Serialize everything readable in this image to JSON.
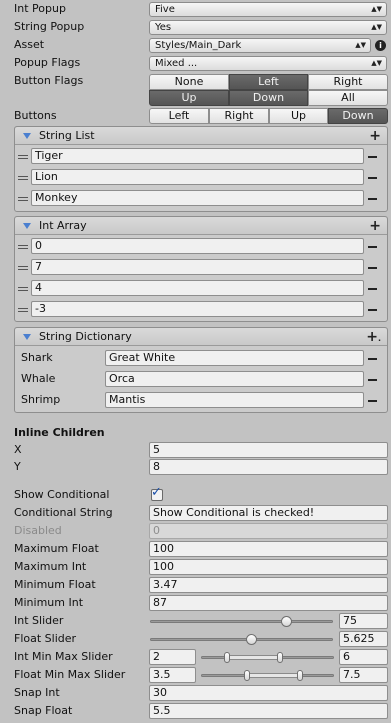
{
  "top_fields": [
    {
      "label": "Int Popup",
      "value": "Five"
    },
    {
      "label": "String Popup",
      "value": "Yes"
    },
    {
      "label": "Asset",
      "value": "Styles/Main_Dark"
    },
    {
      "label": "Popup Flags",
      "value": "Mixed ..."
    }
  ],
  "asset_info_icon": "info-icon",
  "button_flags": {
    "label": "Button Flags",
    "buttons": [
      {
        "label": "None",
        "active": false
      },
      {
        "label": "Left",
        "active": true
      },
      {
        "label": "Right",
        "active": false
      },
      {
        "label": "Up",
        "active": true
      },
      {
        "label": "Down",
        "active": true
      },
      {
        "label": "All",
        "active": false
      }
    ]
  },
  "buttons_row": {
    "label": "Buttons",
    "buttons": [
      {
        "label": "Left",
        "active": false
      },
      {
        "label": "Right",
        "active": false
      },
      {
        "label": "Up",
        "active": false
      },
      {
        "label": "Down",
        "active": true
      }
    ]
  },
  "string_list": {
    "title": "String List",
    "items": [
      "Tiger",
      "Lion",
      "Monkey"
    ]
  },
  "int_array": {
    "title": "Int Array",
    "items": [
      "0",
      "7",
      "4",
      "-3"
    ]
  },
  "string_dictionary": {
    "title": "String Dictionary",
    "entries": [
      {
        "key": "Shark",
        "value": "Great White"
      },
      {
        "key": "Whale",
        "value": "Orca"
      },
      {
        "key": "Shrimp",
        "value": "Mantis"
      }
    ]
  },
  "inline_children": {
    "title": "Inline Children",
    "x_label": "X",
    "x_value": "5",
    "y_label": "Y",
    "y_value": "8"
  },
  "show_conditional": {
    "label": "Show Conditional",
    "checked": true
  },
  "conditional_string": {
    "label": "Conditional String",
    "value": "Show Conditional is checked!"
  },
  "disabled": {
    "label": "Disabled",
    "value": "0"
  },
  "maximum_float": {
    "label": "Maximum Float",
    "value": "100"
  },
  "maximum_int": {
    "label": "Maximum Int",
    "value": "100"
  },
  "minimum_float": {
    "label": "Minimum Float",
    "value": "3.47"
  },
  "minimum_int": {
    "label": "Minimum Int",
    "value": "87"
  },
  "int_slider": {
    "label": "Int Slider",
    "value": "75",
    "fraction": 0.75
  },
  "float_slider": {
    "label": "Float Slider",
    "value": "5.625",
    "fraction": 0.5625
  },
  "int_min_max_slider": {
    "label": "Int Min Max Slider",
    "min": "2",
    "max": "6",
    "fraction_low": 0.2,
    "fraction_high": 0.6
  },
  "float_min_max_slider": {
    "label": "Float Min Max Slider",
    "min": "3.5",
    "max": "7.5",
    "fraction_low": 0.35,
    "fraction_high": 0.75
  },
  "snap_int": {
    "label": "Snap Int",
    "value": "30"
  },
  "snap_float": {
    "label": "Snap Float",
    "value": "5.5"
  },
  "colors": {
    "header_accent": "#4a7fd0",
    "active_button": "#5e5e5e",
    "background": "#c2c2c2"
  }
}
